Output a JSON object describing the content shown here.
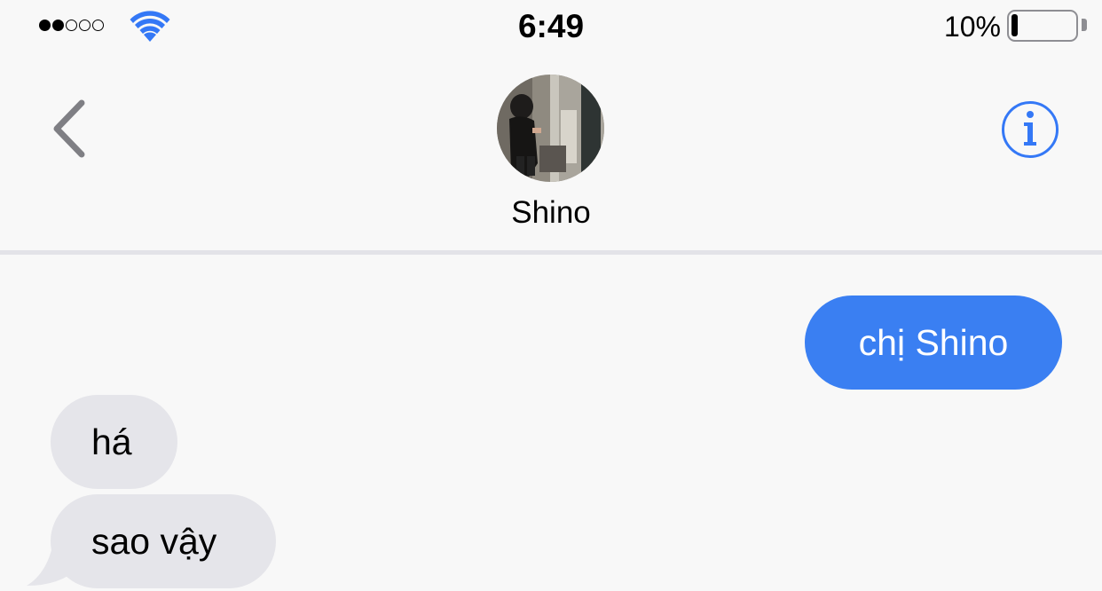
{
  "status_bar": {
    "time": "6:49",
    "battery_percent": "10%",
    "battery_level": 0.1,
    "signal_bars_filled": 2,
    "signal_bars_total": 5
  },
  "header": {
    "contact_name": "Shino",
    "back_icon": "chevron-left-icon",
    "info_icon": "info-icon"
  },
  "messages": [
    {
      "direction": "sent",
      "text": "chị Shino"
    },
    {
      "direction": "received",
      "text": "há"
    },
    {
      "direction": "received",
      "text": "sao vậy"
    }
  ],
  "colors": {
    "sent_bubble": "#3a7ff2",
    "received_bubble": "#e5e5ea",
    "accent": "#3478f6",
    "background": "#f8f8f8"
  }
}
